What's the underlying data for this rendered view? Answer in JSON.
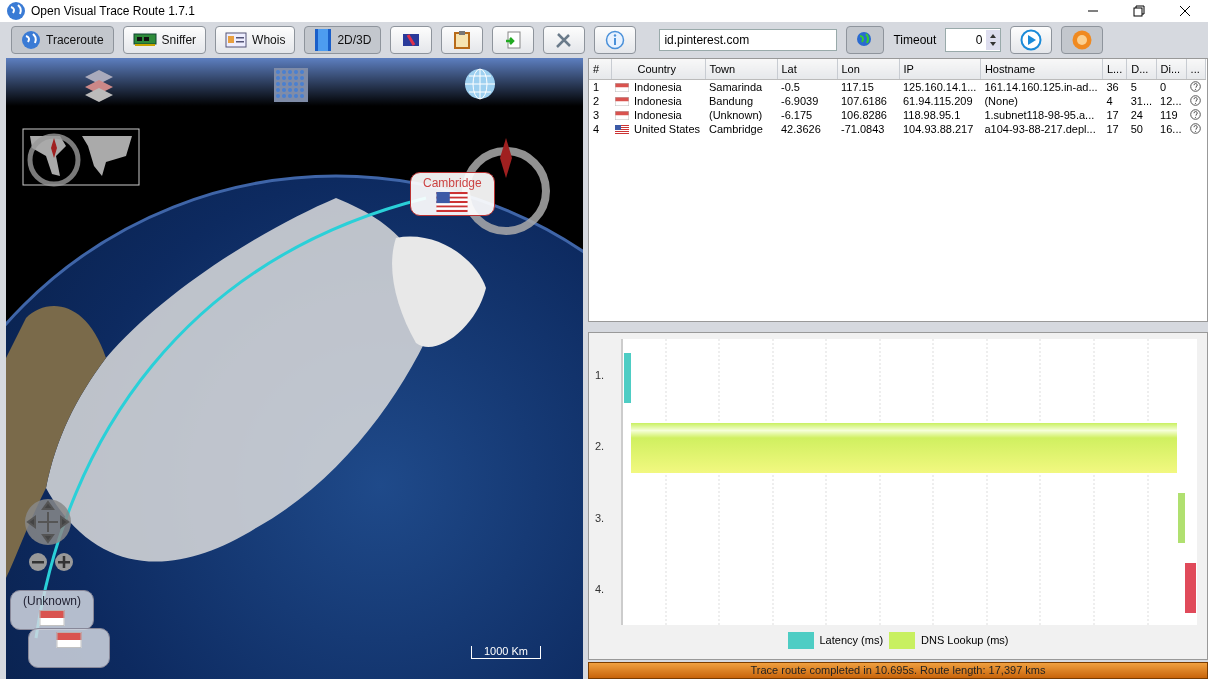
{
  "window": {
    "title": "Open Visual Trace Route 1.7.1"
  },
  "toolbar": {
    "buttons": [
      {
        "label": "Traceroute",
        "kind": "globe",
        "selected": true
      },
      {
        "label": "Sniffer",
        "kind": "card",
        "selected": false
      },
      {
        "label": "Whois",
        "kind": "id",
        "selected": false
      },
      {
        "label": "2D/3D",
        "kind": "cube",
        "selected": true
      }
    ],
    "host_field": {
      "value": "id.pinterest.com"
    },
    "timeout_label": "Timeout",
    "timeout_value": "0"
  },
  "map": {
    "bubbles": [
      {
        "label": "Cambridge",
        "kind": "us"
      },
      {
        "label": "(Unknown)",
        "kind": "id"
      }
    ],
    "scale": "1000 Km"
  },
  "table": {
    "columns": [
      "#",
      "Country",
      "Town",
      "Lat",
      "Lon",
      "IP",
      "Hostname",
      "L...",
      "D...",
      "Di...",
      "..."
    ],
    "rows": [
      {
        "cells": [
          "1",
          "Indonesia",
          "Samarinda",
          "-0.5",
          "117.15",
          "125.160.14.1...",
          "161.14.160.125.in-ad...",
          "36",
          "5",
          "0"
        ],
        "kind": "id"
      },
      {
        "cells": [
          "2",
          "Indonesia",
          "Bandung",
          "-6.9039",
          "107.6186",
          "61.94.115.209",
          "(None)",
          "4",
          "31...",
          "12..."
        ],
        "kind": "id"
      },
      {
        "cells": [
          "3",
          "Indonesia",
          "(Unknown)",
          "-6.175",
          "106.8286",
          "118.98.95.1",
          "1.subnet118-98-95.a...",
          "17",
          "24",
          "119"
        ],
        "kind": "id"
      },
      {
        "cells": [
          "4",
          "United States",
          "Cambridge",
          "42.3626",
          "-71.0843",
          "104.93.88.217",
          "a104-93-88-217.depl...",
          "17",
          "50",
          "16..."
        ],
        "kind": "us"
      }
    ]
  },
  "timeline": {
    "hops": [
      "1.",
      "2.",
      "3.",
      "4."
    ],
    "legend": [
      {
        "label": "Latency (ms)",
        "color": "#4ecdc4"
      },
      {
        "label": "DNS Lookup (ms)",
        "color": "#c8f060"
      }
    ]
  },
  "status_bar": "Trace route completed in 10.695s. Route length: 17,397 kms"
}
